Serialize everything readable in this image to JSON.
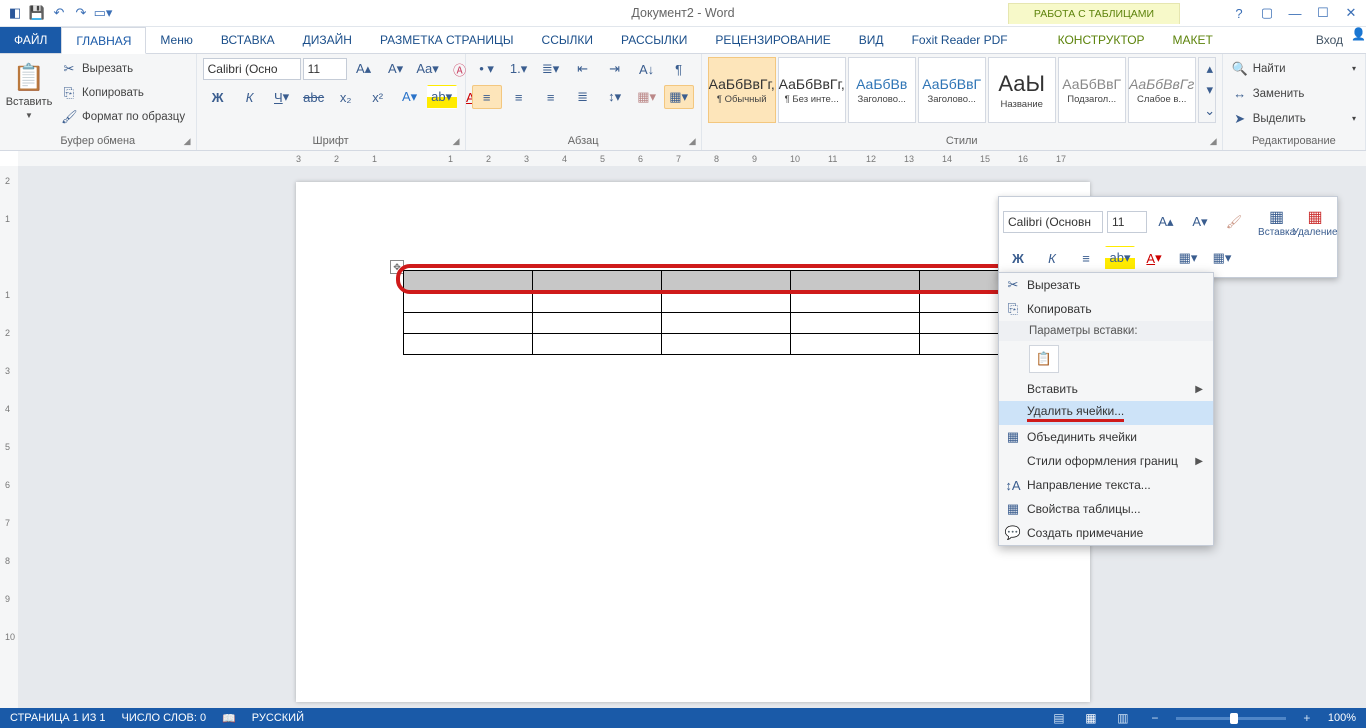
{
  "qat": {
    "title": "Документ2 - Word",
    "tabletools": "РАБОТА С ТАБЛИЦАМИ",
    "login": "Вход"
  },
  "tabs": [
    "ФАЙЛ",
    "ГЛАВНАЯ",
    "Меню",
    "ВСТАВКА",
    "ДИЗАЙН",
    "РАЗМЕТКА СТРАНИЦЫ",
    "ССЫЛКИ",
    "РАССЫЛКИ",
    "РЕЦЕНЗИРОВАНИЕ",
    "ВИД",
    "Foxit Reader PDF",
    "КОНСТРУКТОР",
    "МАКЕТ"
  ],
  "ribbon": {
    "paste": "Вставить",
    "cut": "Вырезать",
    "copy": "Копировать",
    "format": "Формат по образцу",
    "grp_clip": "Буфер обмена",
    "grp_font": "Шрифт",
    "grp_para": "Абзац",
    "grp_styles": "Стили",
    "grp_edit": "Редактирование",
    "font": "Calibri (Осно",
    "size": "11",
    "find": "Найти",
    "replace": "Заменить",
    "select": "Выделить"
  },
  "styles": [
    {
      "p": "АаБбВвГг,",
      "n": "¶ Обычный"
    },
    {
      "p": "АаБбВвГг,",
      "n": "¶ Без инте..."
    },
    {
      "p": "АаБбВв",
      "n": "Заголово..."
    },
    {
      "p": "АаБбВвГ",
      "n": "Заголово..."
    },
    {
      "p": "АаЫ",
      "n": "Название"
    },
    {
      "p": "АаБбВвГ",
      "n": "Подзагол..."
    },
    {
      "p": "АаБбВвГг",
      "n": "Слабое в..."
    }
  ],
  "hruler": [
    "3",
    "2",
    "1",
    "",
    "1",
    "2",
    "3",
    "4",
    "5",
    "6",
    "7",
    "8",
    "9",
    "10",
    "11",
    "12",
    "13",
    "14",
    "15",
    "16",
    "17"
  ],
  "vruler": [
    "2",
    "1",
    "",
    "1",
    "2",
    "3",
    "4",
    "5",
    "6",
    "7",
    "8",
    "9",
    "10"
  ],
  "mini": {
    "font": "Calibri (Основн",
    "size": "11",
    "insert": "Вставка",
    "delete": "Удаление"
  },
  "ctx": {
    "cut": "Вырезать",
    "copy": "Копировать",
    "pasteopts": "Параметры вставки:",
    "insert": "Вставить",
    "delcells": "Удалить ячейки...",
    "merge": "Объединить ячейки",
    "bstyles": "Стили оформления границ",
    "tdir": "Направление текста...",
    "tprops": "Свойства таблицы...",
    "comment": "Создать примечание"
  },
  "status": {
    "page": "СТРАНИЦА 1 ИЗ 1",
    "words": "ЧИСЛО СЛОВ: 0",
    "lang": "РУССКИЙ",
    "zoom": "100%"
  }
}
